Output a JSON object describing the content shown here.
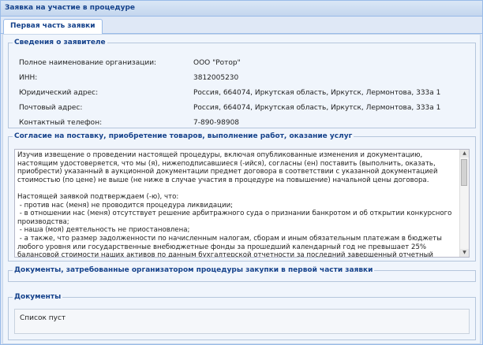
{
  "window": {
    "title": "Заявка на участие в процедуре"
  },
  "tabs": [
    {
      "label": "Первая часть заявки",
      "active": true
    }
  ],
  "applicant": {
    "legend": "Сведения о заявителе",
    "rows": [
      {
        "label": "Полное наименование организации:",
        "value": "ООО \"Ротор\""
      },
      {
        "label": "ИНН:",
        "value": "3812005230"
      },
      {
        "label": "Юридический адрес:",
        "value": "Россия, 664074, Иркутская область, Иркутск, Лермонтова, 333а 1"
      },
      {
        "label": "Почтовый адрес:",
        "value": "Россия, 664074, Иркутская область, Иркутск, Лермонтова, 333а 1"
      },
      {
        "label": "Контактный телефон:",
        "value": "7-890-98908"
      }
    ]
  },
  "consent": {
    "legend": "Согласие на поставку, приобретение товаров, выполнение работ, оказание услуг",
    "text": "Изучив извещение о проведении настоящей процедуры, включая опубликованные изменения и документацию, настоящим удостоверяется, что мы (я), нижеподписавшиеся (-ийся), согласны (ен) поставить (выполнить, оказать, приобрести) указанный в аукционной документации предмет договора в соответствии с указанной документацией стоимостью (по цене) не выше (не ниже в случае участия в процедуре на повышение) начальной цены договора.\n\nНастоящей заявкой подтверждаем (-ю), что:\n - против нас (меня) не проводится процедура ликвидации;\n - в отношении нас (меня) отсутствует решение арбитражного суда о признании банкротом и об открытии конкурсного производства;\n - наша (моя) деятельность не приостановлена;\n - а также, что размер задолженности по начисленным налогам, сборам и иным обязательным платежам в бюджеты любого уровня или государственные внебюджетные фонды за прошедший календарный год не превышает 25% балансовой стоимости наших активов по данным бухгалтерской отчетности за последний завершенный отчетный период."
  },
  "required_docs": {
    "legend": "Документы, затребованные организатором процедуры закупки в первой части заявки"
  },
  "documents": {
    "legend": "Документы",
    "empty_text": "Список пуст"
  },
  "icons": {
    "scroll_up": "▲",
    "scroll_down": "▼"
  }
}
